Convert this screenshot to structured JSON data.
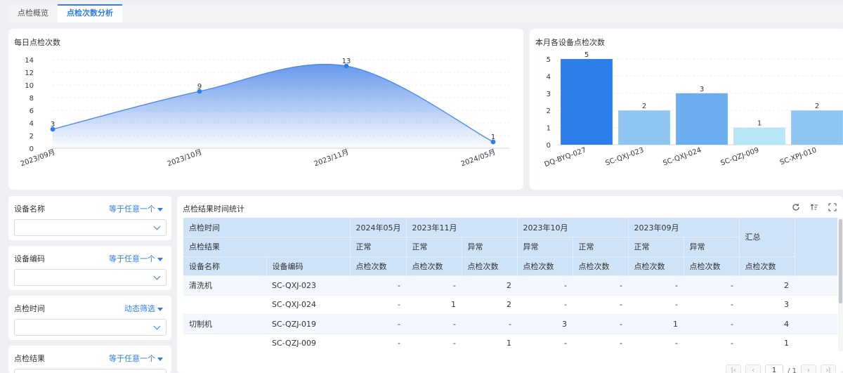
{
  "tabs": [
    {
      "label": "点检概览",
      "active": false
    },
    {
      "label": "点检次数分析",
      "active": true
    }
  ],
  "line_chart": {
    "title": "每日点检次数",
    "chart_data": {
      "type": "area",
      "x": [
        "2023/09月",
        "2023/10月",
        "2023/11月",
        "2024/05月"
      ],
      "values": [
        3,
        9,
        13,
        1
      ],
      "ylim": [
        0,
        14
      ],
      "yticks": [
        0,
        2,
        4,
        6,
        8,
        10,
        12,
        14
      ],
      "grid": true,
      "color": "#4a86e8"
    }
  },
  "bar_chart": {
    "title": "本月各设备点检次数",
    "chart_data": {
      "type": "bar",
      "categories": [
        "DQ-BYQ-027",
        "SC-QXJ-023",
        "SC-QXJ-024",
        "SC-QZJ-009",
        "SC-XPJ-010"
      ],
      "values": [
        5,
        2,
        3,
        1,
        2
      ],
      "colors": [
        "#2f7de8",
        "#8fc6f1",
        "#6aaeef",
        "#b7e6f7",
        "#8fc6f1"
      ],
      "ylim": [
        0,
        5
      ],
      "yticks": [
        0,
        1,
        2,
        3,
        4,
        5
      ],
      "grid": true
    }
  },
  "filters": [
    {
      "label": "设备名称",
      "mode": "等于任意一个",
      "value": ""
    },
    {
      "label": "设备编码",
      "mode": "等于任意一个",
      "value": ""
    },
    {
      "label": "点检时间",
      "mode": "动态筛选",
      "value": ""
    },
    {
      "label": "点检结果",
      "mode": "等于任意一个",
      "value": ""
    }
  ],
  "table": {
    "title": "点检结果时间统计",
    "header": {
      "time_label": "点检时间",
      "result_label": "点检结果",
      "name_col": "设备名称",
      "code_col": "设备编码",
      "periods": [
        "2024年05月",
        "2023年11月",
        "2023年10月",
        "2023年09月"
      ],
      "results": [
        "正常",
        "正常",
        "异常",
        "异常",
        "正常",
        "正常",
        "异常"
      ],
      "measure": "点检次数",
      "total": "汇总"
    },
    "rows": [
      {
        "name": "清洗机",
        "code": "SC-QXJ-023",
        "cells": [
          "-",
          "-",
          "2",
          "-",
          "-",
          "-",
          "-"
        ],
        "total": "2"
      },
      {
        "name": "",
        "code": "SC-QXJ-024",
        "cells": [
          "-",
          "1",
          "2",
          "-",
          "-",
          "-",
          "-"
        ],
        "total": "3"
      },
      {
        "name": "切制机",
        "code": "SC-QZJ-019",
        "cells": [
          "-",
          "-",
          "-",
          "3",
          "-",
          "1",
          "-"
        ],
        "total": "4"
      },
      {
        "name": "",
        "code": "SC-QZJ-009",
        "cells": [
          "-",
          "-",
          "1",
          "-",
          "-",
          "-",
          "-"
        ],
        "total": "1"
      }
    ],
    "pagination": {
      "current": "1",
      "total": "/ 1"
    }
  }
}
